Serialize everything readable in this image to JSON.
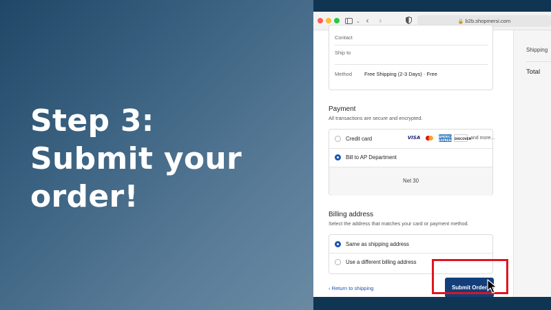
{
  "headline": [
    "Step 3:",
    "Submit your",
    "order!"
  ],
  "browser": {
    "url": "b2b.shopmersi.com"
  },
  "summary": {
    "contact_label": "Contact",
    "ship_to_label": "Ship to",
    "method_label": "Method",
    "method_value": "Free Shipping (2-3 Days) · Free"
  },
  "payment": {
    "title": "Payment",
    "subtitle": "All transactions are secure and encrypted.",
    "options": [
      {
        "label": "Credit card",
        "selected": false
      },
      {
        "label": "Bill to AP Department",
        "selected": true
      }
    ],
    "card_logos": [
      "VISA",
      "mastercard",
      "AMERICAN EXPRESS",
      "DISCOVER"
    ],
    "more_text": "and more...",
    "terms": "Net 30"
  },
  "billing": {
    "title": "Billing address",
    "subtitle": "Select the address that matches your card or payment method.",
    "options": [
      {
        "label": "Same as shipping address",
        "selected": true
      },
      {
        "label": "Use a different billing address",
        "selected": false
      }
    ]
  },
  "actions": {
    "return_label": "Return to shipping",
    "return_icon": "chevron-left-icon",
    "submit_label": "Submit Order"
  },
  "sidebar": {
    "shipping_label": "Shipping",
    "total_label": "Total"
  },
  "colors": {
    "accent": "#123f7a",
    "link": "#1a56b0",
    "highlight": "#e0141e"
  }
}
